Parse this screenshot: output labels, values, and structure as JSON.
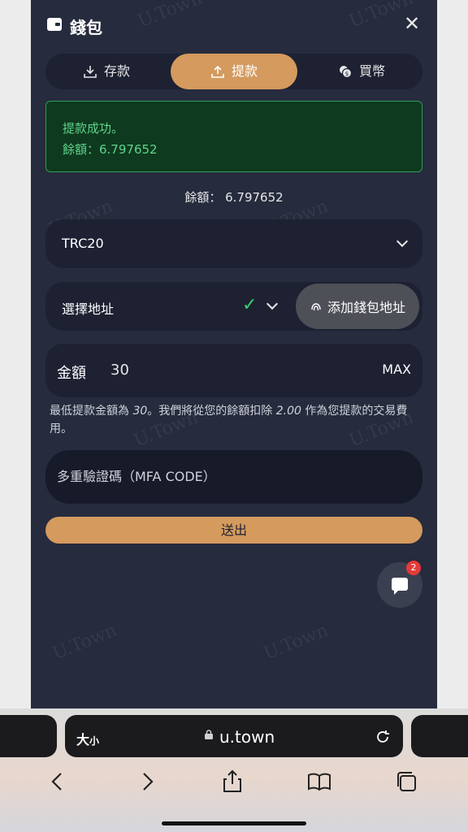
{
  "header": {
    "title": "錢包"
  },
  "tabs": [
    {
      "label": "存款",
      "icon": "download-icon",
      "active": false
    },
    {
      "label": "提款",
      "icon": "upload-icon",
      "active": true
    },
    {
      "label": "買幣",
      "icon": "coins-icon",
      "active": false
    }
  ],
  "success": {
    "line1": "提款成功。",
    "line2": "餘額：6.797652"
  },
  "balance": {
    "label": "餘額：",
    "value": "6.797652"
  },
  "network": {
    "selected": "TRC20"
  },
  "address": {
    "label": "選擇地址",
    "add_button": "添加錢包地址"
  },
  "amount": {
    "label": "金額",
    "value": "30",
    "max_label": "MAX"
  },
  "hint": {
    "part1": "最低提款金額為 ",
    "min": "30",
    "part2": "。我們將從您的餘額扣除 ",
    "fee": "2.00",
    "part3": " 作為您提款的交易費用。"
  },
  "mfa": {
    "placeholder": "多重驗證碼（MFA CODE）"
  },
  "submit": {
    "label": "送出"
  },
  "chat": {
    "badge": "2"
  },
  "watermark": "U.Town",
  "browser": {
    "text_size_big": "大",
    "text_size_small": "小",
    "url": "u.town"
  },
  "colors": {
    "accent": "#d49a5e",
    "success": "#5fd38a",
    "background": "#262b3d"
  }
}
